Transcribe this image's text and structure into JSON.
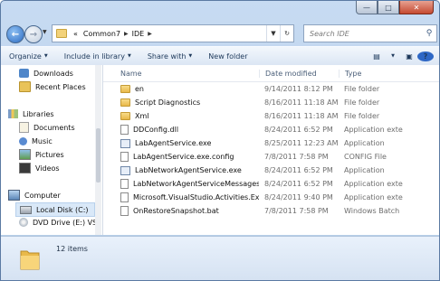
{
  "breadcrumb": {
    "prefix": "«",
    "parts": [
      "Common7",
      "IDE"
    ]
  },
  "search": {
    "placeholder": "Search IDE"
  },
  "toolbar": {
    "organize": "Organize",
    "include_in_library": "Include in library",
    "share_with": "Share with",
    "new_folder": "New folder"
  },
  "nav": [
    {
      "label": "Downloads",
      "icon": "downloads-icon"
    },
    {
      "label": "Recent Places",
      "icon": "recent-places-icon"
    },
    {
      "label": "Libraries",
      "icon": "libraries-icon"
    },
    {
      "label": "Documents",
      "icon": "documents-icon"
    },
    {
      "label": "Music",
      "icon": "music-icon"
    },
    {
      "label": "Pictures",
      "icon": "pictures-icon"
    },
    {
      "label": "Videos",
      "icon": "videos-icon"
    },
    {
      "label": "Computer",
      "icon": "computer-icon"
    },
    {
      "label": "Local Disk (C:)",
      "icon": "local-disk-icon"
    },
    {
      "label": "DVD Drive (E:) VS",
      "icon": "dvd-drive-icon"
    }
  ],
  "columns": {
    "name": "Name",
    "date": "Date modified",
    "type": "Type"
  },
  "files": [
    {
      "name": "en",
      "date": "9/14/2011 8:12 PM",
      "type": "File folder",
      "kind": "folder"
    },
    {
      "name": "Script Diagnostics",
      "date": "8/16/2011 11:18 AM",
      "type": "File folder",
      "kind": "folder"
    },
    {
      "name": "Xml",
      "date": "8/16/2011 11:18 AM",
      "type": "File folder",
      "kind": "folder"
    },
    {
      "name": "DDConfig.dll",
      "date": "8/24/2011 6:52 PM",
      "type": "Application exte",
      "kind": "file"
    },
    {
      "name": "LabAgentService.exe",
      "date": "8/25/2011 12:23 AM",
      "type": "Application",
      "kind": "exe"
    },
    {
      "name": "LabAgentService.exe.config",
      "date": "7/8/2011 7:58 PM",
      "type": "CONFIG File",
      "kind": "file"
    },
    {
      "name": "LabNetworkAgentService.exe",
      "date": "8/24/2011 6:52 PM",
      "type": "Application",
      "kind": "exe"
    },
    {
      "name": "LabNetworkAgentServiceMessages.dll",
      "date": "8/24/2011 6:52 PM",
      "type": "Application exte",
      "kind": "file"
    },
    {
      "name": "Microsoft.VisualStudio.Activities.Expressi...",
      "date": "8/24/2011 9:40 PM",
      "type": "Application exte",
      "kind": "file"
    },
    {
      "name": "OnRestoreSnapshot.bat",
      "date": "7/8/2011 7:58 PM",
      "type": "Windows Batch",
      "kind": "file"
    }
  ],
  "status": {
    "item_count": "12 items"
  }
}
